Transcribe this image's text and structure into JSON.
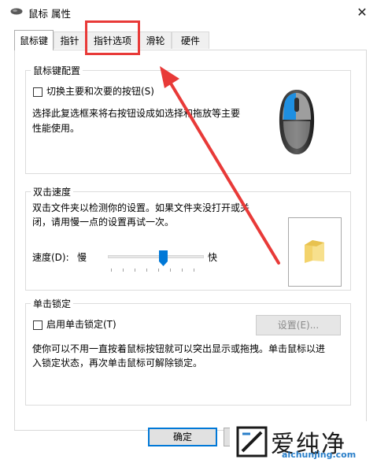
{
  "window": {
    "title": "鼠标 属性",
    "close_glyph": "✕"
  },
  "tabs": [
    {
      "label": "鼠标键",
      "active": true
    },
    {
      "label": "指针",
      "active": false
    },
    {
      "label": "指针选项",
      "active": false
    },
    {
      "label": "滑轮",
      "active": false
    },
    {
      "label": "硬件",
      "active": false
    }
  ],
  "button_config": {
    "title": "鼠标键配置",
    "switch_checkbox_label": "切换主要和次要的按钮(S)",
    "switch_checked": false,
    "description_line1": "选择此复选框来将右按钮设成如选择和拖放等主要",
    "description_line2": "性能使用。"
  },
  "double_click": {
    "title": "双击速度",
    "description_line1": "双击文件夹以检测你的设置。如果文件夹没打开或关",
    "description_line2": "闭，请用慢一点的设置再试一次。",
    "speed_label": "速度(D):",
    "slow_label": "慢",
    "fast_label": "快",
    "speed_level": 0.55
  },
  "click_lock": {
    "title": "单击锁定",
    "checkbox_label": "启用单击锁定(T)",
    "checked": false,
    "settings_button": "设置(E)...",
    "description_line1": "使你可以不用一直按着鼠标按钮就可以突出显示或拖拽。单击鼠标以进",
    "description_line2": "入锁定状态，再次单击鼠标可解除锁定。"
  },
  "footer": {
    "ok_label": "确定"
  },
  "watermark": {
    "text": "爱纯净",
    "url": "aichunjing.com"
  },
  "colors": {
    "accent": "#0078d7",
    "annotation_red": "#e83a38",
    "mouse_blue": "#1e8fe1"
  }
}
